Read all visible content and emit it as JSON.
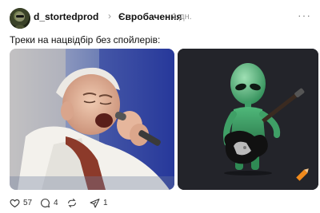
{
  "header": {
    "username": "d_stortedprod",
    "separator": "›",
    "community": "Євробачення",
    "time_ago": "1 дн.",
    "more_icon": "more-horizontal-icon"
  },
  "post": {
    "text": "Треки на нацвідбір без спойлерів:"
  },
  "images": [
    {
      "name": "pope-singing-image"
    },
    {
      "name": "alien-guitar-image"
    }
  ],
  "actions": {
    "likes": "57",
    "comments": "4",
    "reposts": "",
    "shares": "1"
  },
  "colors": {
    "left_image_bg": "#2f3f9a",
    "right_image_bg": "#23242a",
    "alien_green": "#3fa66a",
    "watermark": "#f08a1c"
  }
}
